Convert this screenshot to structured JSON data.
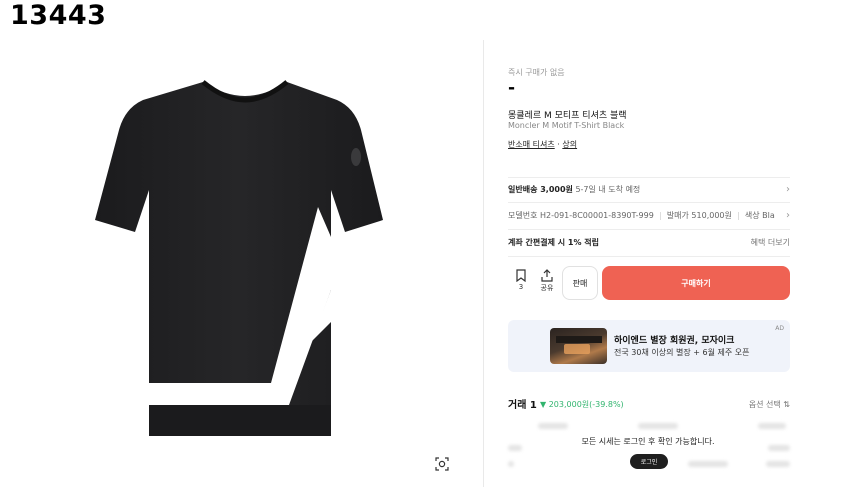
{
  "listing": {
    "id": "13443"
  },
  "product": {
    "instant_label": "즉시 구매가 없음",
    "price": "-",
    "name_ko": "몽클레르 M 모티프 티셔츠 블랙",
    "name_en": "Moncler M Motif T-Shirt Black",
    "category": "반소매 티셔츠",
    "category_sep": " · ",
    "subcategory": "상의"
  },
  "shipping": {
    "label": "일반배송 3,000원",
    "eta": "5-7일 내 도착 예정"
  },
  "specs": {
    "model": "모델번호 H2-091-8C00001-8390T-999",
    "release_price": "발매가 510,000원",
    "color": "색상 Black"
  },
  "payment": {
    "label": "계좌 간편결제 시 1% 적립",
    "link": "혜택 더보기"
  },
  "actions": {
    "bookmark_count": "3",
    "share_label": "공유",
    "sell_label": "판매",
    "buy_label": "구매하기"
  },
  "ad": {
    "title": "하이엔드 별장 회원권, 모자이크",
    "subtitle": "전국 30채 이상의 별장 + 6월 제주 오픈",
    "tag": "AD"
  },
  "trades": {
    "title": "거래 1",
    "change": "▼ 203,000원(-39.8%)",
    "option_label": "옵션 선택 ⇅",
    "login_message": "모든 시세는 로그인 후 확인 가능합니다.",
    "login_button": "로그인"
  },
  "colors": {
    "buy": "#ef6253",
    "down": "#31b46e",
    "ad_bg": "#f0f3fa"
  }
}
